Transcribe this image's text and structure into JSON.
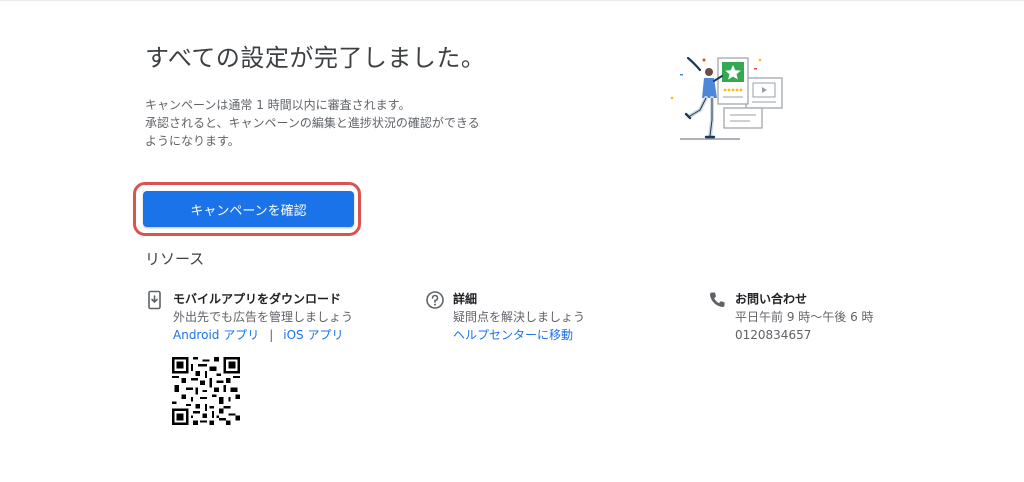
{
  "header": {
    "title": "すべての設定が完了しました。",
    "description": [
      "キャンペーンは通常 1 時間以内に審査されます。",
      "承認されると、キャンペーンの編集と進捗状況の確認ができる",
      "ようになります。"
    ]
  },
  "cta": {
    "label": "キャンペーンを確認"
  },
  "resources": {
    "heading": "リソース",
    "mobile_app": {
      "icon": "phone-download-icon",
      "title": "モバイルアプリをダウンロード",
      "subtitle": "外出先でも広告を管理しましょう",
      "android_link": "Android アプリ",
      "separator": "|",
      "ios_link": "iOS アプリ"
    },
    "details": {
      "icon": "help-circle-icon",
      "title": "詳細",
      "subtitle": "疑問点を解決しましょう",
      "help_link": "ヘルプセンターに移動"
    },
    "contact": {
      "icon": "phone-icon",
      "title": "お問い合わせ",
      "hours": "平日午前 9 時〜午後 6 時",
      "phone": "0120834657"
    }
  },
  "colors": {
    "primary_blue": "#1a73e8",
    "highlight_red": "#d9534f",
    "illustration_green": "#34a853"
  }
}
